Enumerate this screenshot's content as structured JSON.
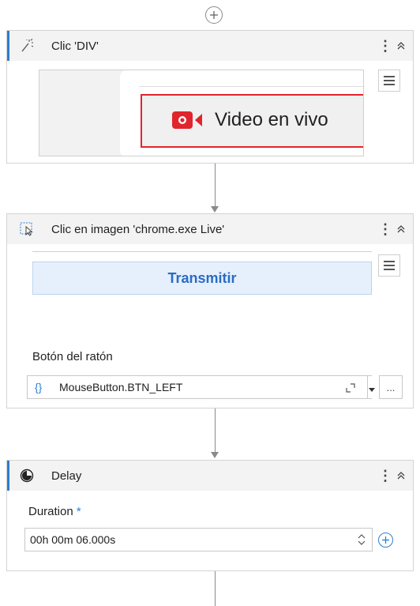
{
  "cards": {
    "click_div": {
      "title": "Clic 'DIV'",
      "preview_label": "Video en vivo"
    },
    "click_image": {
      "title": "Clic en imagen 'chrome.exe Live'",
      "preview_label": "Transmitir",
      "mouse_button_label": "Botón del ratón",
      "mouse_button_value": "MouseButton.BTN_LEFT",
      "expression_badge": "{}",
      "more_label": "..."
    },
    "delay": {
      "title": "Delay",
      "duration_label": "Duration",
      "required_mark": "*",
      "duration_value": "00h 00m 06.000s"
    }
  },
  "colors": {
    "accent": "#2b7fd4",
    "selection_red": "#e0252c",
    "link_blue": "#2a6cc4"
  }
}
